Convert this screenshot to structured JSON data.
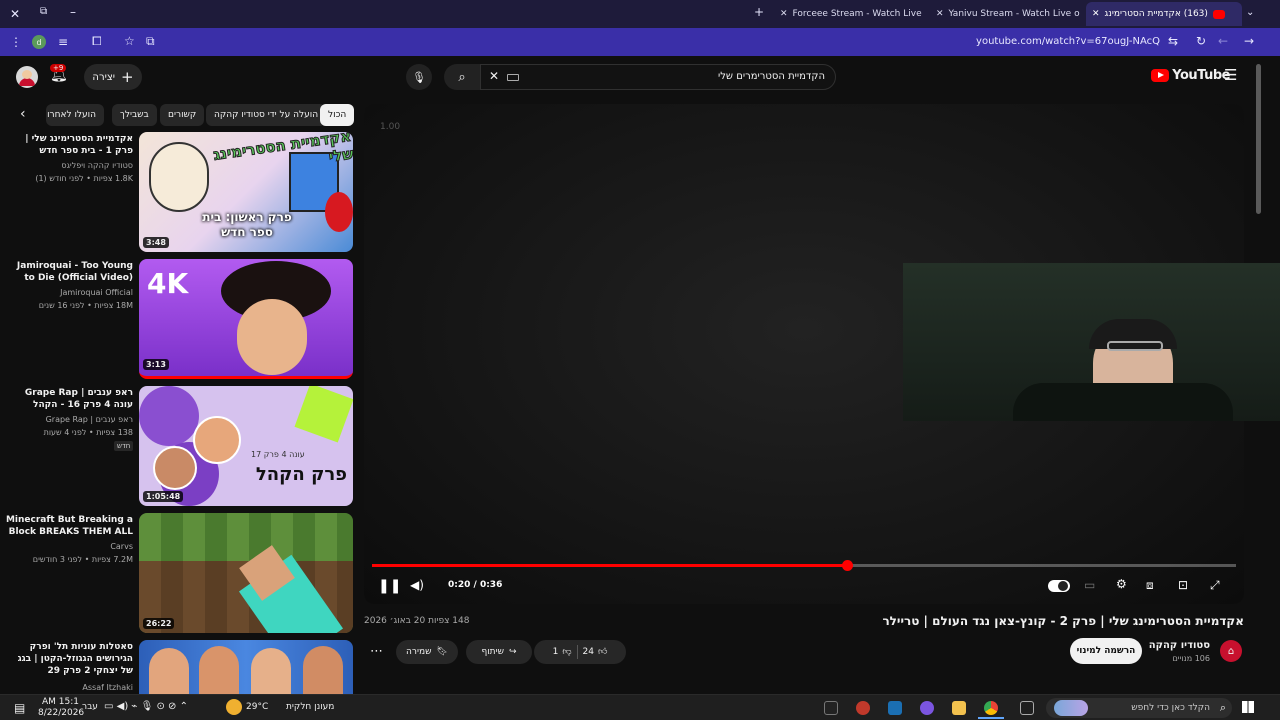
{
  "browser": {
    "tabs": [
      {
        "label": "Forceee Stream - Watch Live on"
      },
      {
        "label": "Yanivu Stream - Watch Live on"
      },
      {
        "label": "(163) אקדמיית הסטרימינג"
      }
    ],
    "url": "youtube.com/watch?v=67ougJ-NAcQ"
  },
  "header": {
    "search_query": "הקדמיית הסטרימרים שלי",
    "create_label": "יצירה",
    "notif_count": "+9",
    "logo_text": "YouTube"
  },
  "chips": [
    "הכול",
    "הועלה על ידי סטודיו קהקה",
    "קשורים",
    "בשבילך",
    "הועלו לאחרו"
  ],
  "sidebar_videos": [
    {
      "title": "אקדמיית הסטרימינג שלי | פרק 1 - בית ספר חדש",
      "channel": "סטודיו קהקה ויפליגס",
      "meta": "1.8K צפיות • לפני חודש (1)",
      "duration": "3:48",
      "thumb_text_top": "אקדמיית הסטרימינג שלי",
      "thumb_text_bottom": "פרק ראשון: בית ספר חדש",
      "thumb_color": "#4a8bd6"
    },
    {
      "title": "Jamiroquai - Too Young to Die (Official Video)",
      "channel": "Jamiroquai Official",
      "meta": "18M צפיות • לפני 16 שנים",
      "duration": "3:13",
      "thumb_text_top": "4K",
      "thumb_text_bottom": "",
      "thumb_color": "#8a3fd1"
    },
    {
      "title": "ראפ ענבים | Grape Rap עונה 4 פרק 16 - הקהל",
      "channel": "ראפ ענבים | Grape Rap",
      "meta": "138 צפיות • לפני 4 שעות",
      "badge": "חדש",
      "duration": "1:05:48",
      "thumb_text_top": "עונה 4 פרק 17",
      "thumb_text_bottom": "פרק הקהל",
      "thumb_color": "#b889e6"
    },
    {
      "title": "Minecraft But Breaking a Block BREAKS THEM ALL",
      "channel": "Carvs",
      "meta": "7.2M צפיות • לפני 3 חודשים",
      "duration": "26:22",
      "thumb_text_top": "",
      "thumb_text_bottom": "",
      "thumb_color": "#5a8a3a"
    },
    {
      "title": "סאטלות עוניות תל' ופרק הגירושים הגגוזל-הקטן | בגג של יצחקי 2 פרק 29",
      "channel": "Assaf Itzhaki",
      "meta": "",
      "duration": "",
      "thumb_text_top": "",
      "thumb_text_bottom": "",
      "thumb_color": "#3a6fc9"
    }
  ],
  "player": {
    "overlay_text": "1.00",
    "time": "0:20 / 0:36",
    "progress": 0.55
  },
  "watch": {
    "title": "אקדמיית הסטרימינג שלי | פרק 2 - קונץ-צאן נגד העולם | טריילר",
    "meta": "148 צפיות  20 באוג׳ 2026",
    "like_count": "24",
    "dislike_count": "1",
    "share_label": "שיתוף",
    "save_label": "שמירה",
    "subscribe_label": "הרשמה למינוי",
    "channel_name": "סטודיו קהקה",
    "channel_subs": "106 מנויים"
  },
  "taskbar": {
    "time": "AM 15:1",
    "date": "8/22/2026",
    "lang": "עבר",
    "weather_temp": "29°C",
    "weather_desc": "מעונן חלקית",
    "search_placeholder": "הקלד כאן כדי לחפש"
  },
  "colors": {
    "accent": "#ff0000",
    "browser": "#3a2fa8"
  }
}
